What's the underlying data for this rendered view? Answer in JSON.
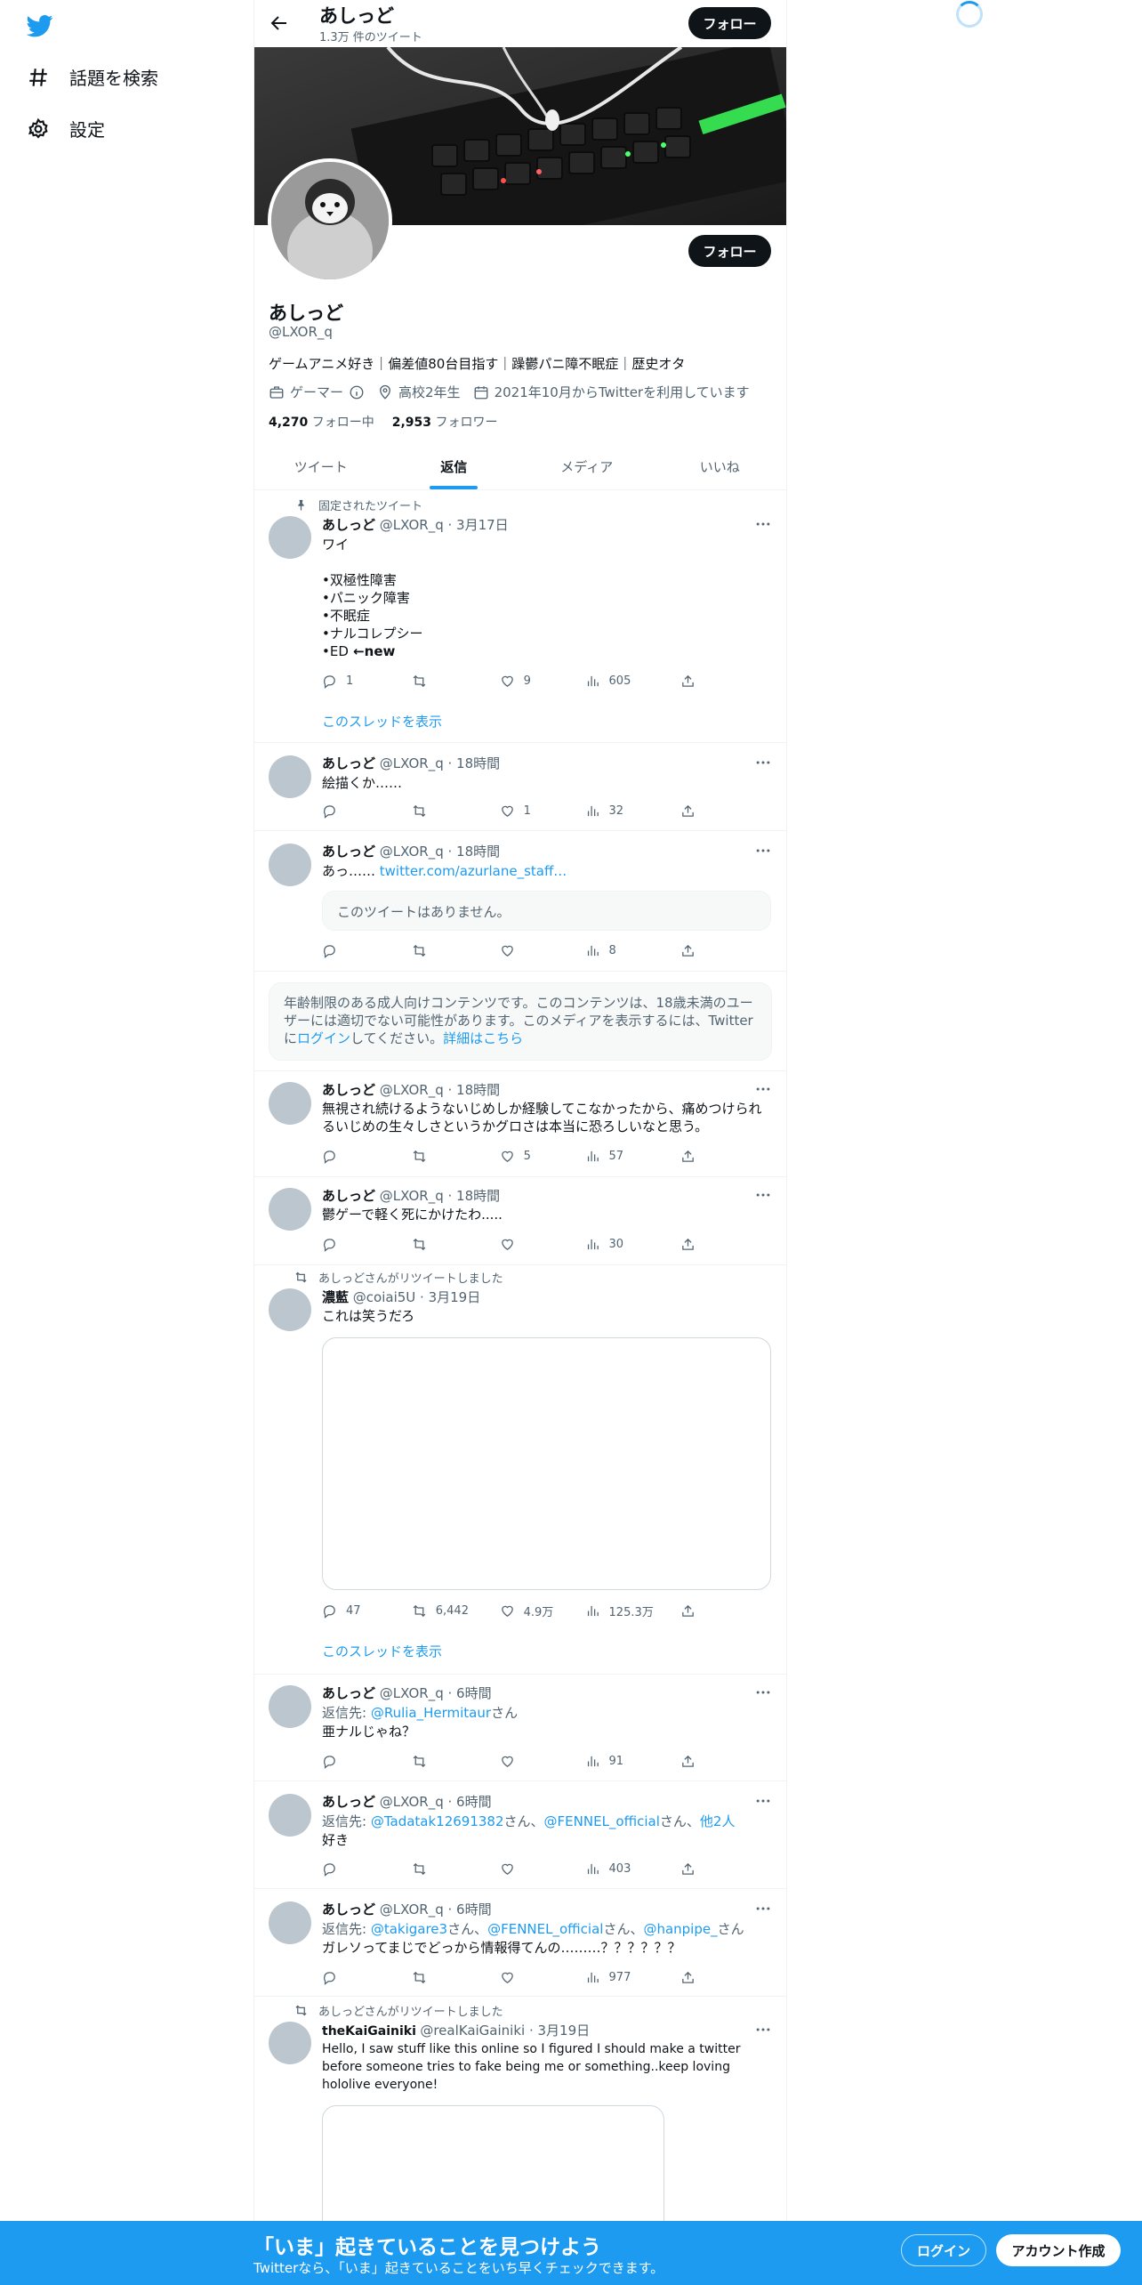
{
  "nav": {
    "explore_label": "話題を検索",
    "settings_label": "設定"
  },
  "header": {
    "name": "あしっど",
    "tweet_count": "1.3万 件のツイート",
    "follow_label": "フォロー"
  },
  "profile": {
    "name": "あしっど",
    "handle": "@LXOR_q",
    "bio": "ゲームアニメ好き｜偏差値80台目指す｜躁鬱パニ障不眠症｜歴史オタ",
    "category": "ゲーマー",
    "location": "高校2年生",
    "joined": "2021年10月からTwitterを利用しています",
    "following_count": "4,270",
    "following_label": "フォロー中",
    "followers_count": "2,953",
    "followers_label": "フォロワー",
    "follow_label": "フォロー"
  },
  "tabs": [
    {
      "label": "ツイート"
    },
    {
      "label": "返信"
    },
    {
      "label": "メディア"
    },
    {
      "label": "いいね"
    }
  ],
  "tweets": {
    "t1": {
      "context": "固定されたツイート",
      "name": "あしっど",
      "handle": "@LXOR_q",
      "time": " · 3月17日",
      "body_lines": [
        "ワイ",
        "",
        "•双極性障害",
        "•パニック障害",
        "•不眠症",
        "•ナルコレプシー",
        "•ED"
      ],
      "new_tag": " ←new",
      "replies": "1",
      "retweets": "",
      "likes": "9",
      "views": "605",
      "thread_label": "このスレッドを表示"
    },
    "t2": {
      "name": "あしっど",
      "handle": "@LXOR_q",
      "time": " · 18時間",
      "body": "絵描くか……",
      "likes": "1",
      "views": "32"
    },
    "t3": {
      "name": "あしっど",
      "handle": "@LXOR_q",
      "time": " · 18時間",
      "body_prefix": "あっ…… ",
      "link": "twitter.com/azurlane_staff…",
      "quote": "このツイートはありません。",
      "views": "8"
    },
    "sensitive": {
      "text1": "年齢制限のある成人向けコンテンツです。このコンテンツは、18歳未満のユーザーには適切でない可能性があります。このメディアを表示するには、Twitter",
      "text2_prefix": "に",
      "login_link": "ログイン",
      "text2_mid": "してください。",
      "details_link": "詳細はこちら"
    },
    "t4": {
      "name": "あしっど",
      "handle": "@LXOR_q",
      "time": " · 18時間",
      "body": "無視され続けるようないじめしか経験してこなかったから、痛めつけられるいじめの生々しさというかグロさは本当に恐ろしいなと思う。",
      "likes": "5",
      "views": "57"
    },
    "t5": {
      "name": "あしっど",
      "handle": "@LXOR_q",
      "time": " · 18時間",
      "body": "鬱ゲーで軽く死にかけたわ.....",
      "views": "30"
    },
    "t6": {
      "context": "あしっどさんがリツイートしました",
      "name": "濃藍",
      "handle": "@coiai5U",
      "time": " · 3月19日",
      "body": "これは笑うだろ",
      "replies": "47",
      "retweets": "6,442",
      "likes": "4.9万",
      "views": "125.3万",
      "thread_label": "このスレッドを表示"
    },
    "t7": {
      "name": "あしっど",
      "handle": "@LXOR_q",
      "time": " · 6時間",
      "reply_prefix": "返信先: ",
      "reply_to": "@Rulia_Hermitaur",
      "reply_suffix": "さん",
      "body": "亜ナルじゃね？",
      "views": "91"
    },
    "t8": {
      "name": "あしっど",
      "handle": "@LXOR_q",
      "time": " · 6時間",
      "reply_prefix": "返信先: ",
      "reply_to1": "@Tadatak12691382",
      "reply_mid1": "さん、",
      "reply_to2": "@FENNEL_official",
      "reply_mid2": "さん、",
      "reply_others": "他2人",
      "body": "好き",
      "views": "403"
    },
    "t9": {
      "name": "あしっど",
      "handle": "@LXOR_q",
      "time": " · 6時間",
      "reply_prefix": "返信先: ",
      "reply_to1": "@takigare3",
      "reply_mid1": "さん、",
      "reply_to2": "@FENNEL_official",
      "reply_mid2": "さん、",
      "reply_to3": "@hanpipe_",
      "reply_suffix": "さん",
      "body": "ガレソってまじでどっから情報得てんの………？？？？？？",
      "views": "977"
    },
    "t10": {
      "context": "あしっどさんがリツイートしました",
      "name": "theKaiGainiki",
      "handle": "@realKaiGainiki",
      "time": " · 3月19日",
      "body": "Hello, I saw stuff like this online so I figured I should make a twitter before someone tries to fake being me or something..keep loving hololive everyone!"
    }
  },
  "bottom": {
    "title": "「いま」起きていることを見つけよう",
    "subtitle": "Twitterなら、「いま」起きていることをいち早くチェックできます。",
    "login_label": "ログイン",
    "signup_label": "アカウント作成"
  }
}
